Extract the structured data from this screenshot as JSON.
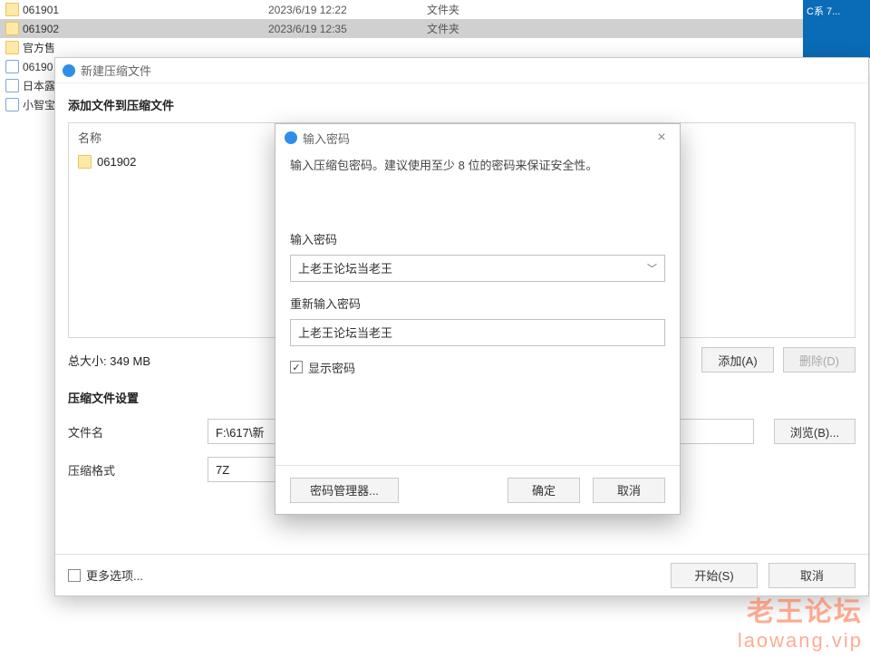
{
  "explorer": {
    "rows": [
      {
        "name": "061901",
        "date": "2023/6/19 12:22",
        "type": "文件夹",
        "kind": "folder",
        "selected": false
      },
      {
        "name": "061902",
        "date": "2023/6/19 12:35",
        "type": "文件夹",
        "kind": "folder",
        "selected": true
      },
      {
        "name": "官方售",
        "date": "",
        "type": "",
        "kind": "folder",
        "selected": false
      },
      {
        "name": "06190",
        "date": "",
        "type": "",
        "kind": "url",
        "selected": false
      },
      {
        "name": "日本露",
        "date": "",
        "type": "",
        "kind": "web",
        "selected": false
      },
      {
        "name": "小智宝",
        "date": "",
        "type": "",
        "kind": "web",
        "selected": false
      }
    ],
    "desktop_snippet": "C系\n7..."
  },
  "archive_dialog": {
    "title": "新建压缩文件",
    "section_add": "添加文件到压缩文件",
    "list_header": "名称",
    "list_item": "061902",
    "total_size": "总大小: 349 MB",
    "btn_add": "添加(A)",
    "btn_delete": "删除(D)",
    "section_settings": "压缩文件设置",
    "label_filename": "文件名",
    "filename_value": "F:\\617\\新",
    "btn_browse": "浏览(B)...",
    "label_format": "压缩格式",
    "format_value": "7Z",
    "more_options": "更多选项...",
    "btn_start": "开始(S)",
    "btn_cancel": "取消"
  },
  "password_dialog": {
    "title": "输入密码",
    "hint": "输入压缩包密码。建议使用至少 8 位的密码来保证安全性。",
    "label_pw": "输入密码",
    "pw_value": "上老王论坛当老王",
    "label_confirm": "重新输入密码",
    "confirm_value": "上老王论坛当老王",
    "show_pw": "显示密码",
    "btn_manager": "密码管理器...",
    "btn_ok": "确定",
    "btn_cancel": "取消"
  },
  "watermark": {
    "line1": "老王论坛",
    "line2": "laowang.vip"
  }
}
